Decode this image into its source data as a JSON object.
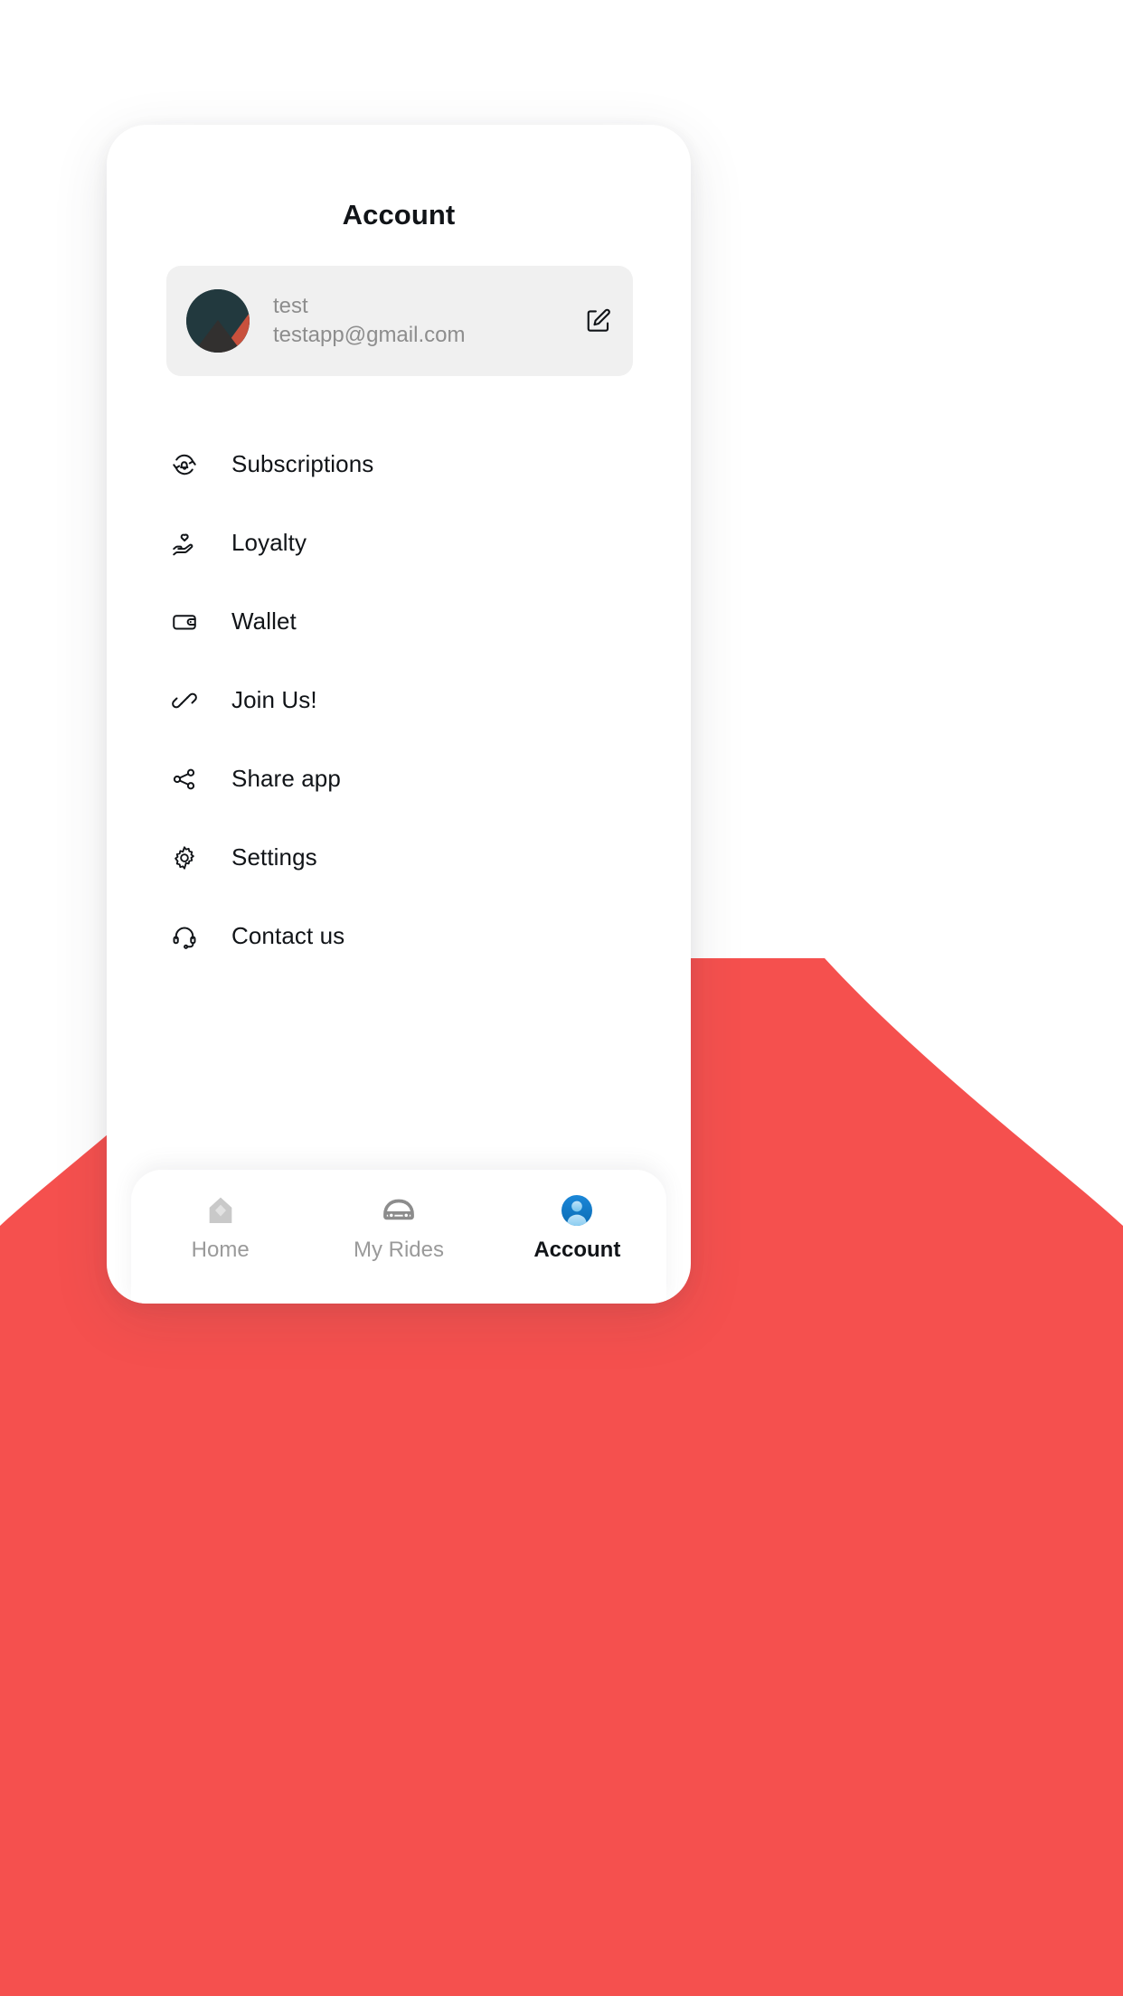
{
  "theme": {
    "brand_red": "#F5504E",
    "card_bg": "#FFFFFF",
    "profile_card_bg": "#F0F0F0",
    "muted_text": "#8D8D8D",
    "primary_text": "#111418",
    "nav_inactive": "#9A9A9A",
    "nav_active_blue": "#1180D0",
    "avatar_dark_teal": "#22393E",
    "avatar_rust": "#C8503C",
    "avatar_charcoal": "#32302F"
  },
  "header": {
    "title": "Account"
  },
  "profile": {
    "avatar_icon": "user-avatar-image",
    "name": "test",
    "email": "testapp@gmail.com",
    "edit_icon": "edit-pencil-icon"
  },
  "menu": {
    "items": [
      {
        "id": "subscriptions",
        "label": "Subscriptions",
        "icon": "subscription-refresh-bell-icon"
      },
      {
        "id": "loyalty",
        "label": "Loyalty",
        "icon": "heart-in-hand-icon"
      },
      {
        "id": "wallet",
        "label": "Wallet",
        "icon": "wallet-icon"
      },
      {
        "id": "join-us",
        "label": "Join Us!",
        "icon": "chain-link-icon"
      },
      {
        "id": "share-app",
        "label": "Share app",
        "icon": "share-nodes-icon"
      },
      {
        "id": "settings",
        "label": "Settings",
        "icon": "gear-icon"
      },
      {
        "id": "contact-us",
        "label": "Contact us",
        "icon": "headset-icon"
      }
    ]
  },
  "bottom_nav": {
    "items": [
      {
        "id": "home",
        "label": "Home",
        "icon": "house-icon",
        "active": false
      },
      {
        "id": "my-rides",
        "label": "My Rides",
        "icon": "car-icon",
        "active": false
      },
      {
        "id": "account",
        "label": "Account",
        "icon": "person-circle-icon",
        "active": true
      }
    ]
  }
}
